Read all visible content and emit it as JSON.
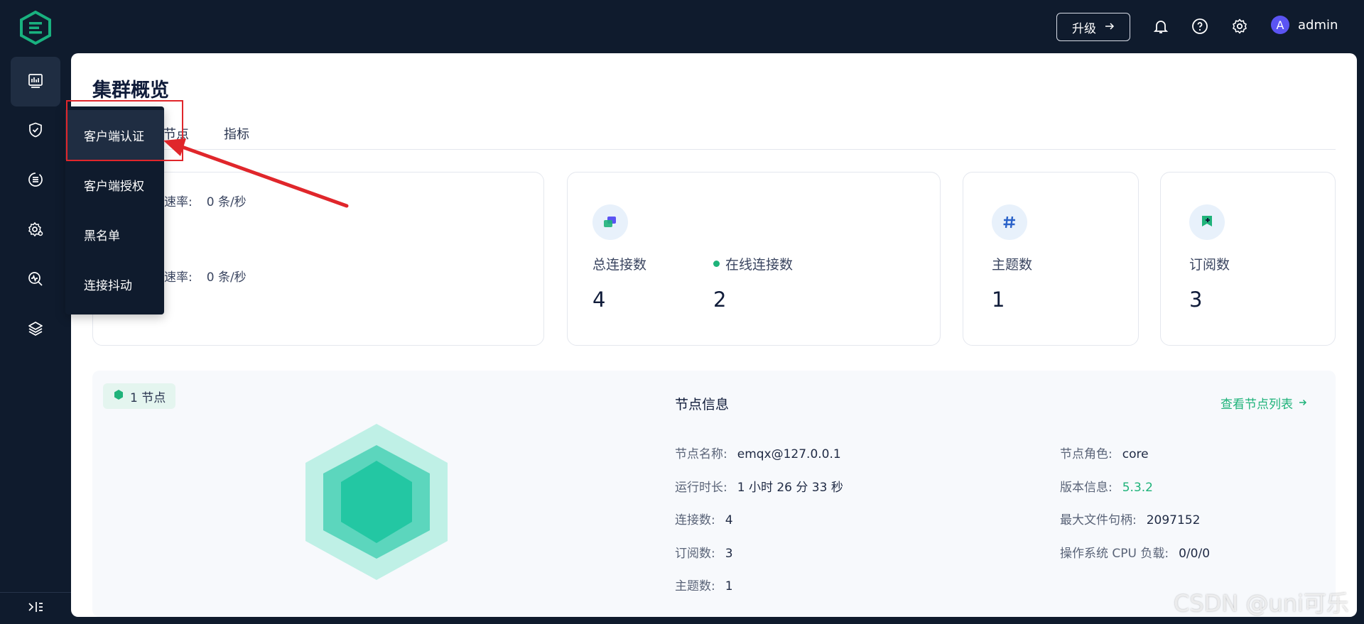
{
  "topbar": {
    "upgrade_label": "升级",
    "user_initial": "A",
    "user_name": "admin"
  },
  "sidebar": {
    "items": [
      {
        "icon": "dashboard-icon",
        "active": true
      },
      {
        "icon": "shield-check-icon",
        "active": false
      },
      {
        "icon": "integration-icon",
        "active": false
      },
      {
        "icon": "gear-management-icon",
        "active": false
      },
      {
        "icon": "diagnose-icon",
        "active": false
      },
      {
        "icon": "layers-icon",
        "active": false
      }
    ],
    "collapse_icon": "collapse-icon"
  },
  "dropdown_menu": {
    "items": [
      "客户端认证",
      "客户端授权",
      "黑名单",
      "连接抖动"
    ],
    "active_index": 0
  },
  "page": {
    "title": "集群概览",
    "tabs": [
      "节点",
      "指标"
    ]
  },
  "rates": {
    "in_label": "速率:",
    "in_value": "0 条/秒",
    "out_label": "速率:",
    "out_value": "0 条/秒"
  },
  "stats": {
    "total_connections_label": "总连接数",
    "total_connections_value": "4",
    "online_connections_label": "在线连接数",
    "online_connections_value": "2",
    "topics_label": "主题数",
    "topics_value": "1",
    "subscriptions_label": "订阅数",
    "subscriptions_value": "3"
  },
  "node_panel": {
    "badge": "1 节点",
    "info_title": "节点信息",
    "link_label": "查看节点列表",
    "left_rows": [
      {
        "label": "节点名称:",
        "value": "emqx@127.0.0.1"
      },
      {
        "label": "运行时长:",
        "value": "1 小时 26 分 33 秒"
      },
      {
        "label": "连接数:",
        "value": "4"
      },
      {
        "label": "订阅数:",
        "value": "3"
      },
      {
        "label": "主题数:",
        "value": "1"
      }
    ],
    "right_rows": [
      {
        "label": "节点角色:",
        "value": "core"
      },
      {
        "label": "版本信息:",
        "value": "5.3.2"
      },
      {
        "label": "最大文件句柄:",
        "value": "2097152"
      },
      {
        "label": "操作系统 CPU 负载:",
        "value": "0/0/0"
      }
    ]
  },
  "colors": {
    "accent": "#1fb37a",
    "sidebar_bg": "#0f1b2d",
    "annotation_red": "#e0262b"
  },
  "watermark": "CSDN @uni可乐"
}
